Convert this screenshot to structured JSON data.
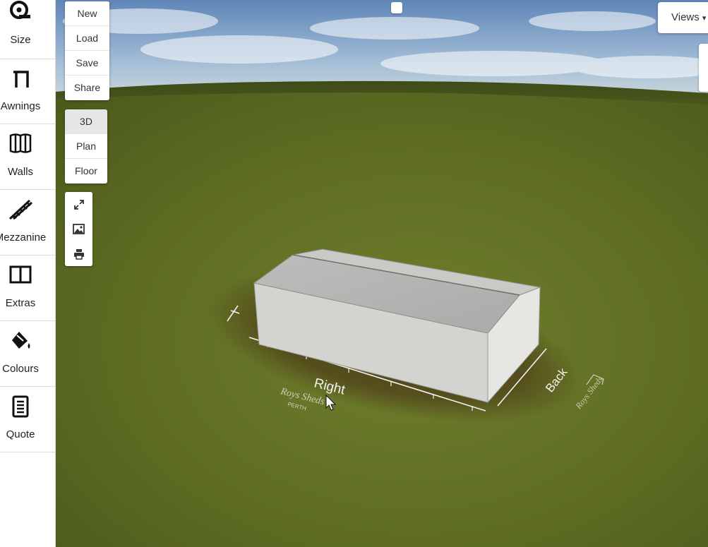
{
  "sidebar": {
    "items": [
      {
        "label": "Size",
        "icon": "tape-measure-icon"
      },
      {
        "label": "Awnings",
        "icon": "awning-icon"
      },
      {
        "label": "Walls",
        "icon": "walls-icon"
      },
      {
        "label": "Mezzanine",
        "icon": "stairs-icon"
      },
      {
        "label": "Extras",
        "icon": "extras-icon"
      },
      {
        "label": "Colours",
        "icon": "paint-bucket-icon"
      },
      {
        "label": "Quote",
        "icon": "quote-document-icon"
      }
    ]
  },
  "file_menu": {
    "new": "New",
    "load": "Load",
    "save": "Save",
    "share": "Share"
  },
  "view_modes": {
    "three_d": "3D",
    "plan": "Plan",
    "floor": "Floor",
    "active": "3D"
  },
  "tools": {
    "fullscreen": "expand-icon",
    "image": "image-icon",
    "print": "print-icon"
  },
  "views": {
    "label": "Views",
    "icon": "chevron-down-icon"
  },
  "scene": {
    "right_label": "Right",
    "back_label": "Back",
    "logo_text": "Roys Sheds",
    "logo_sub": "PERTH"
  },
  "colors": {
    "sidebar_bg": "#ffffff",
    "grass": "#6b7a2a",
    "shed_wall": "#d2d2cf"
  }
}
